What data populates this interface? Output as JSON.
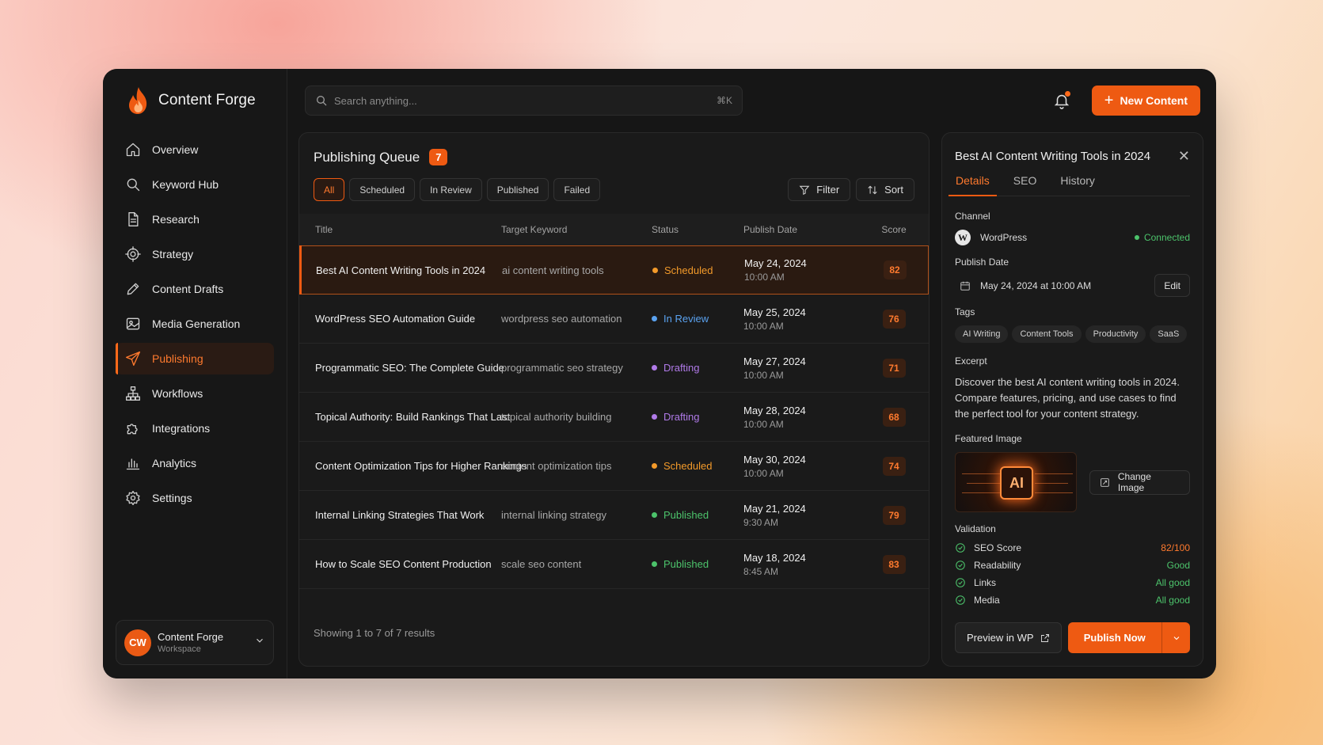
{
  "app": {
    "name": "Content Forge"
  },
  "sidebar": {
    "items": [
      {
        "label": "Overview",
        "icon": "home-icon"
      },
      {
        "label": "Keyword Hub",
        "icon": "search-icon"
      },
      {
        "label": "Research",
        "icon": "document-icon"
      },
      {
        "label": "Strategy",
        "icon": "target-icon"
      },
      {
        "label": "Content Drafts",
        "icon": "pencil-icon"
      },
      {
        "label": "Media Generation",
        "icon": "image-icon"
      },
      {
        "label": "Publishing",
        "icon": "send-icon",
        "active": true
      },
      {
        "label": "Workflows",
        "icon": "workflow-icon"
      },
      {
        "label": "Integrations",
        "icon": "puzzle-icon"
      },
      {
        "label": "Analytics",
        "icon": "chart-icon"
      },
      {
        "label": "Settings",
        "icon": "gear-icon"
      }
    ],
    "workspace": {
      "initials": "CW",
      "name": "Content Forge",
      "sub": "Workspace"
    }
  },
  "topbar": {
    "search_placeholder": "Search anything...",
    "search_shortcut": "⌘K",
    "new_content_label": "New Content"
  },
  "queue": {
    "title": "Publishing Queue",
    "count": "7",
    "tabs": [
      "All",
      "Scheduled",
      "In Review",
      "Published",
      "Failed"
    ],
    "active_tab": "All",
    "filter_label": "Filter",
    "sort_label": "Sort",
    "columns": {
      "title": "Title",
      "keyword": "Target Keyword",
      "status": "Status",
      "date": "Publish Date",
      "score": "Score"
    },
    "rows": [
      {
        "title": "Best AI Content Writing Tools in 2024",
        "keyword": "ai content writing tools",
        "status": "Scheduled",
        "status_color": "#f39a2a",
        "date": "May 24, 2024",
        "time": "10:00 AM",
        "score": "82",
        "selected": true
      },
      {
        "title": "WordPress SEO Automation Guide",
        "keyword": "wordpress seo automation",
        "status": "In Review",
        "status_color": "#5aa2f0",
        "date": "May 25, 2024",
        "time": "10:00 AM",
        "score": "76"
      },
      {
        "title": "Programmatic SEO: The Complete Guide",
        "keyword": "programmatic seo strategy",
        "status": "Drafting",
        "status_color": "#b07ae8",
        "date": "May 27, 2024",
        "time": "10:00 AM",
        "score": "71"
      },
      {
        "title": "Topical Authority: Build Rankings That Last",
        "keyword": "topical authority building",
        "status": "Drafting",
        "status_color": "#b07ae8",
        "date": "May 28, 2024",
        "time": "10:00 AM",
        "score": "68"
      },
      {
        "title": "Content Optimization Tips for Higher Rankings",
        "keyword": "content optimization tips",
        "status": "Scheduled",
        "status_color": "#f39a2a",
        "date": "May 30, 2024",
        "time": "10:00 AM",
        "score": "74"
      },
      {
        "title": "Internal Linking Strategies That Work",
        "keyword": "internal linking strategy",
        "status": "Published",
        "status_color": "#4cc36b",
        "date": "May 21, 2024",
        "time": "9:30 AM",
        "score": "79"
      },
      {
        "title": "How to Scale SEO Content Production",
        "keyword": "scale seo content",
        "status": "Published",
        "status_color": "#4cc36b",
        "date": "May 18, 2024",
        "time": "8:45 AM",
        "score": "83"
      }
    ],
    "footer": "Showing 1 to 7 of 7 results"
  },
  "detail": {
    "title": "Best AI Content Writing Tools in 2024",
    "tabs": [
      "Details",
      "SEO",
      "History"
    ],
    "active_tab": "Details",
    "channel_label": "Channel",
    "channel_name": "WordPress",
    "channel_status": "Connected",
    "publish_date_label": "Publish Date",
    "publish_date": "May 24, 2024 at 10:00 AM",
    "edit_label": "Edit",
    "tags_label": "Tags",
    "tags": [
      "AI Writing",
      "Content Tools",
      "Productivity",
      "SaaS"
    ],
    "excerpt_label": "Excerpt",
    "excerpt": "Discover the best AI content writing tools in 2024. Compare features, pricing, and use cases to find the perfect tool for your content strategy.",
    "featured_image_label": "Featured Image",
    "featured_image_text": "AI",
    "change_image_label": "Change Image",
    "validation_label": "Validation",
    "validation": [
      {
        "name": "SEO Score",
        "value": "82/100",
        "color": "#ff7a2e"
      },
      {
        "name": "Readability",
        "value": "Good",
        "color": "#4cc36b"
      },
      {
        "name": "Links",
        "value": "All good",
        "color": "#4cc36b"
      },
      {
        "name": "Media",
        "value": "All good",
        "color": "#4cc36b"
      }
    ],
    "preview_label": "Preview in WP",
    "publish_label": "Publish Now"
  },
  "colors": {
    "accent": "#ee5a12",
    "background": "#161616",
    "success": "#4cc36b"
  }
}
